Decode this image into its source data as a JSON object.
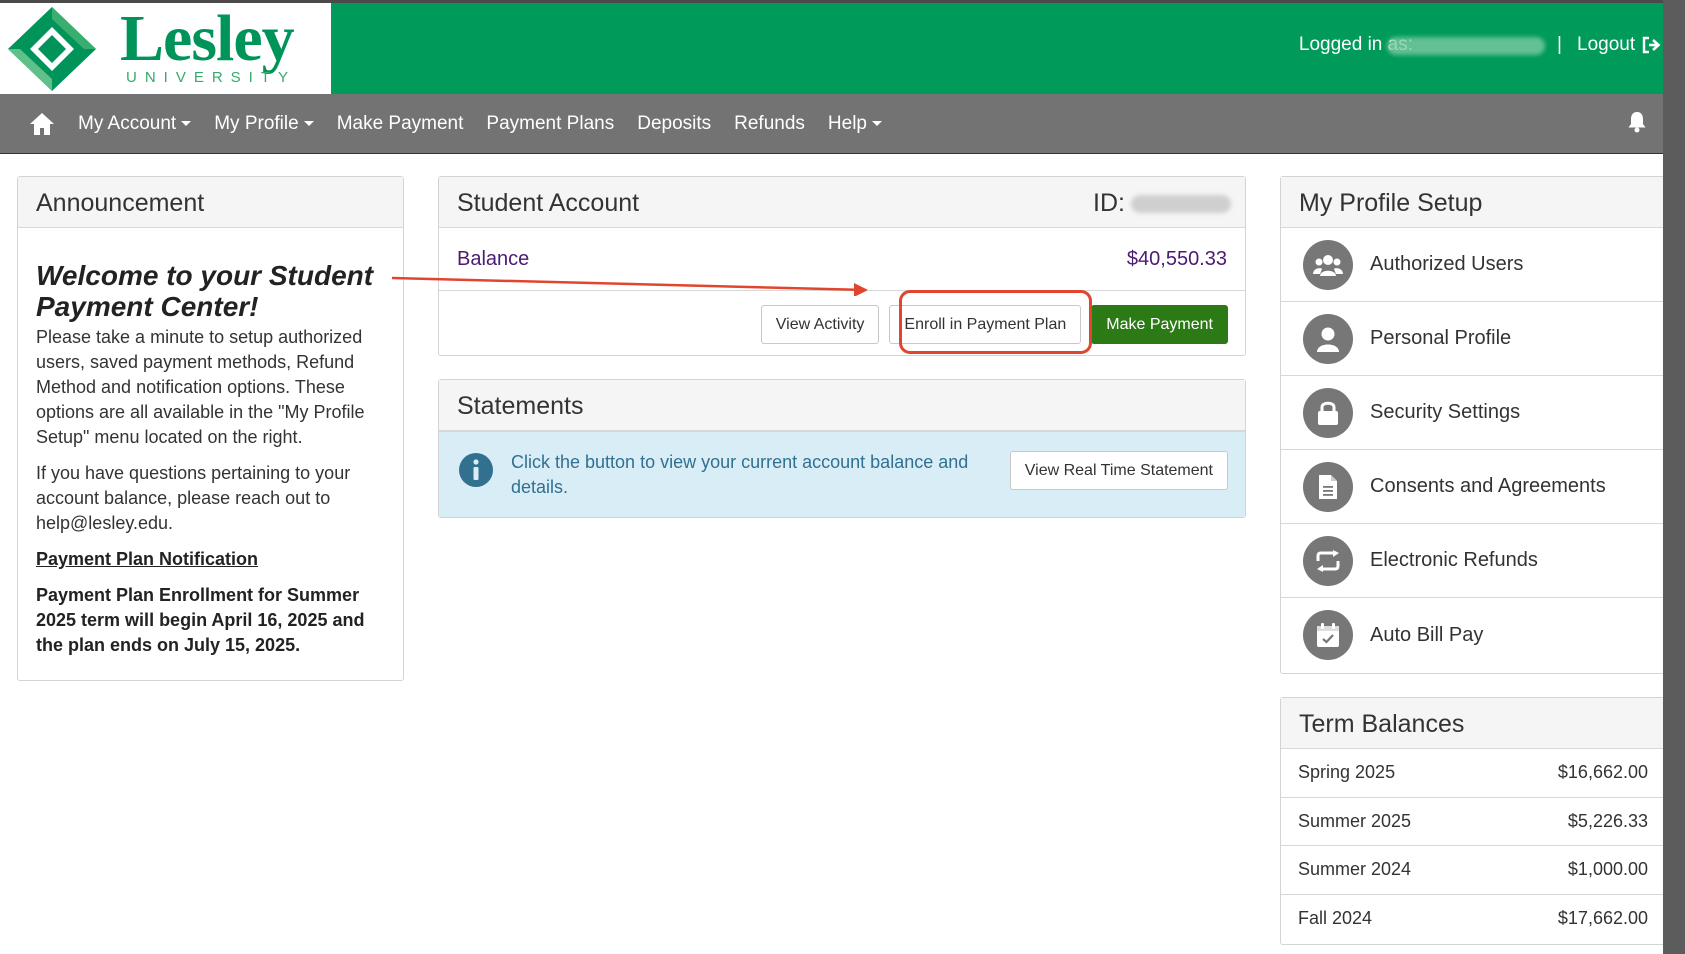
{
  "header": {
    "logo": {
      "word": "Lesley",
      "sub": "UNIVERSITY"
    },
    "logged_in_label": "Logged in as:",
    "separator": "|",
    "logout_label": "Logout"
  },
  "nav": {
    "items": [
      {
        "label": "My Account",
        "dropdown": true
      },
      {
        "label": "My Profile",
        "dropdown": true
      },
      {
        "label": "Make Payment",
        "dropdown": false
      },
      {
        "label": "Payment Plans",
        "dropdown": false
      },
      {
        "label": "Deposits",
        "dropdown": false
      },
      {
        "label": "Refunds",
        "dropdown": false
      },
      {
        "label": "Help",
        "dropdown": true
      }
    ]
  },
  "announcement": {
    "header": "Announcement",
    "title": "Welcome to your Student Payment Center!",
    "p1": "Please take a minute to setup authorized users, saved payment methods, Refund Method  and notification options. These options are all available in the \"My Profile Setup\" menu located on the right.",
    "p2": "If you have questions pertaining to your account balance, please reach out to help@lesley.edu.",
    "link": "Payment Plan Notification",
    "bold": "Payment Plan Enrollment for Summer 2025 term will begin April 16, 2025 and the plan ends on July 15, 2025."
  },
  "student_account": {
    "header": "Student Account",
    "id_label": "ID:",
    "balance_label": "Balance",
    "balance_value": "$40,550.33",
    "buttons": {
      "view_activity": "View Activity",
      "enroll": "Enroll in Payment Plan",
      "make_payment": "Make Payment"
    }
  },
  "statements": {
    "header": "Statements",
    "info_text": "Click the button to view your current account balance and details.",
    "button": "View Real Time Statement"
  },
  "profile_setup": {
    "header": "My Profile Setup",
    "items": [
      {
        "label": "Authorized Users",
        "icon": "users-icon"
      },
      {
        "label": "Personal Profile",
        "icon": "user-icon"
      },
      {
        "label": "Security Settings",
        "icon": "lock-icon"
      },
      {
        "label": "Consents and Agreements",
        "icon": "document-icon"
      },
      {
        "label": "Electronic Refunds",
        "icon": "refresh-icon"
      },
      {
        "label": "Auto Bill Pay",
        "icon": "calendar-icon"
      }
    ]
  },
  "term_balances": {
    "header": "Term Balances",
    "rows": [
      {
        "term": "Spring 2025",
        "amount": "$16,662.00"
      },
      {
        "term": "Summer 2025",
        "amount": "$5,226.33"
      },
      {
        "term": "Summer 2024",
        "amount": "$1,000.00"
      },
      {
        "term": "Fall 2024",
        "amount": "$17,662.00"
      }
    ]
  },
  "colors": {
    "brand_green": "#009a5b",
    "navbar": "#737373",
    "button_green": "#2c7a16",
    "balance_purple": "#4b1a72",
    "highlight_red": "#e2452e",
    "info_bg": "#d9edf7"
  }
}
